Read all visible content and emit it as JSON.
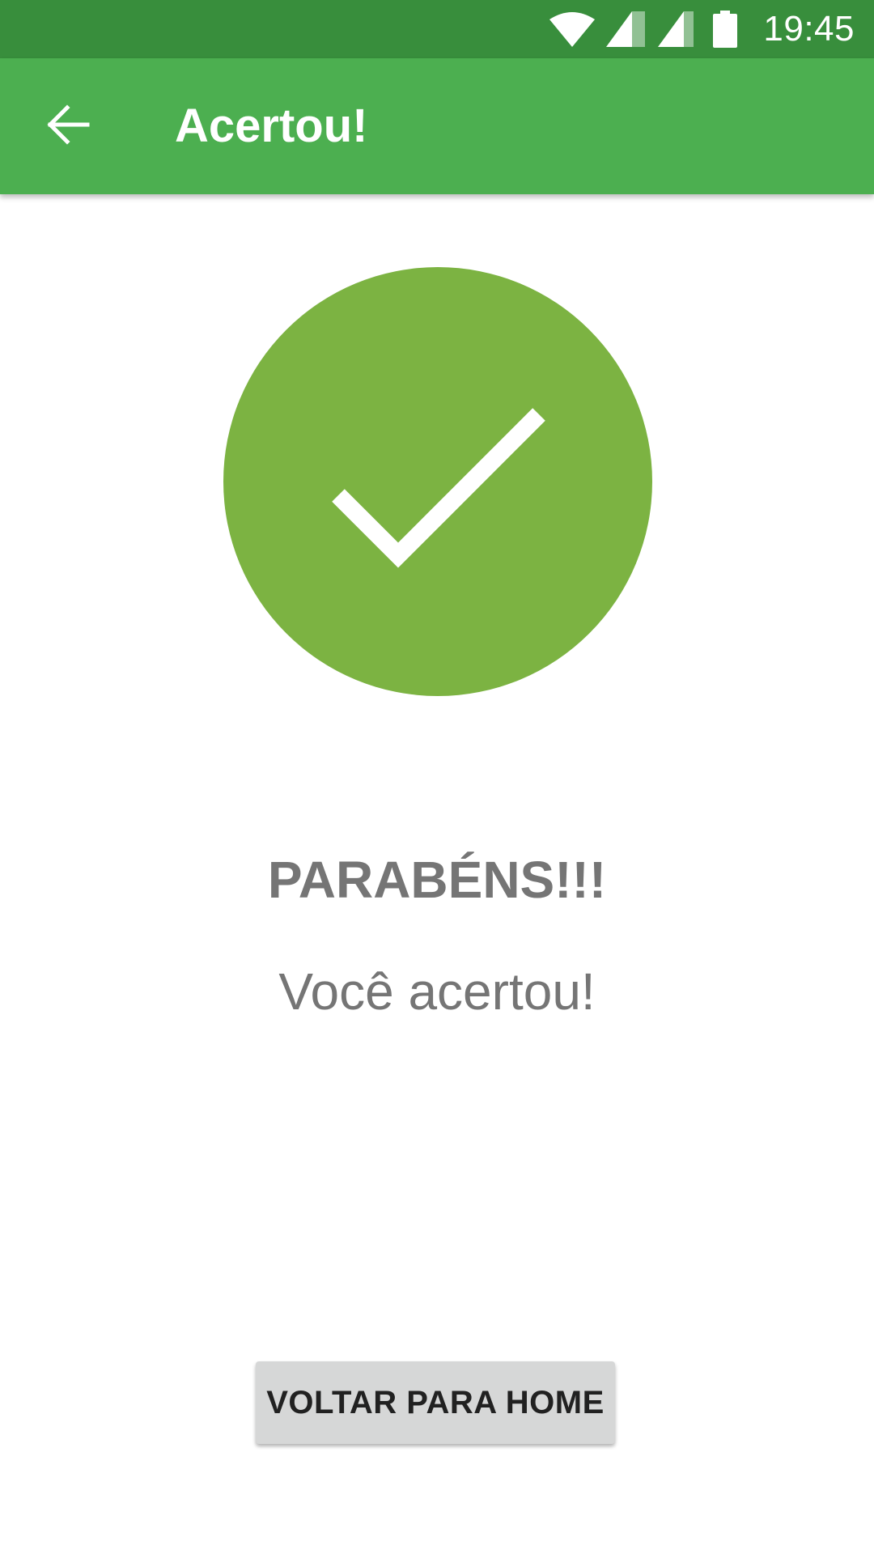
{
  "status_bar": {
    "time": "19:45",
    "background_color": "#388E3C",
    "icons": [
      "wifi-icon",
      "signal-icon",
      "signal-icon",
      "battery-icon"
    ]
  },
  "app_bar": {
    "title": "Acertou!",
    "background_color": "#4CAF50",
    "back_icon": "arrow-back-icon"
  },
  "result": {
    "icon": "check-icon",
    "circle_color": "#7CB342",
    "headline": "PARABÉNS!!!",
    "message": "Você acertou!",
    "text_color": "#757575"
  },
  "actions": {
    "home_button_label": "VOLTAR PARA HOME",
    "home_button_color": "#D6D7D7"
  }
}
